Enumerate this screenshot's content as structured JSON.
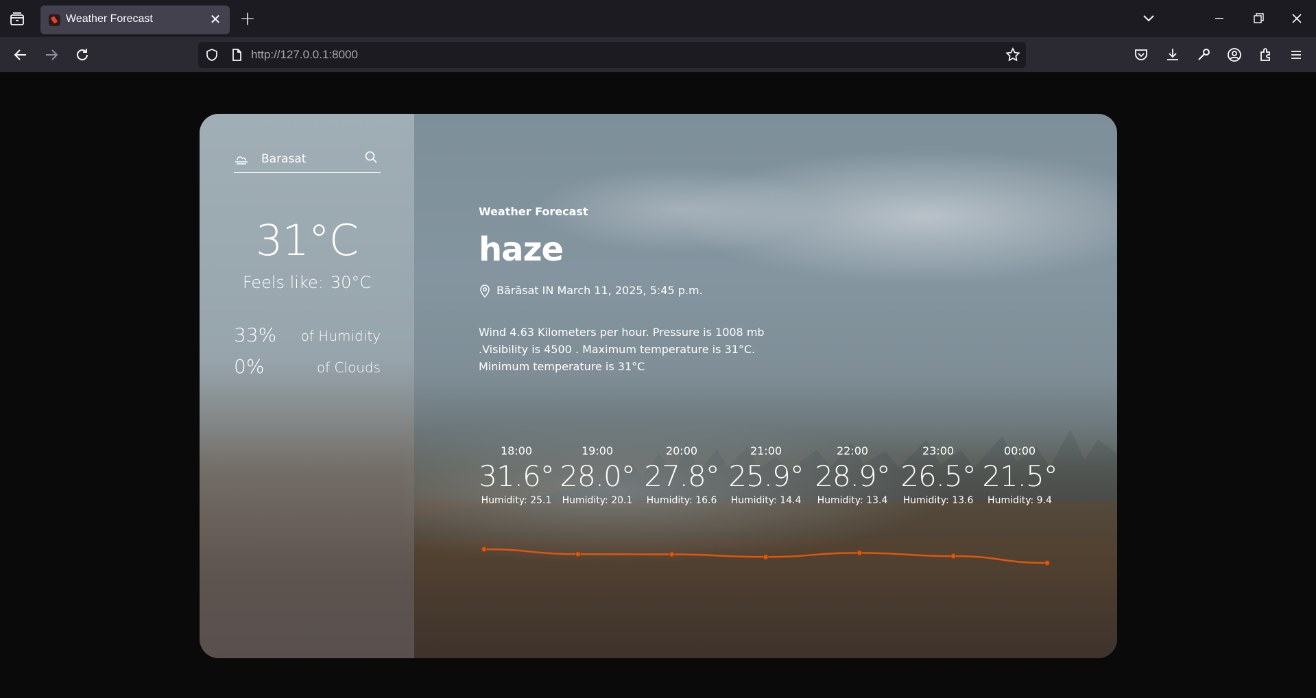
{
  "browser": {
    "tab_title": "Weather Forecast",
    "url_host": "http://127.0.0.1",
    "url_port": ":8000"
  },
  "sidebar": {
    "city": "Barasat",
    "temperature": "31°C",
    "feels_like_label": "Feels like:",
    "feels_like_value": "30°C",
    "humidity_value": "33%",
    "humidity_label": "of Humidity",
    "clouds_value": "0%",
    "clouds_label": "of Clouds"
  },
  "main": {
    "eyebrow": "Weather Forecast",
    "condition": "haze",
    "location": "Bārāsat IN March 11, 2025, 5:45 p.m.",
    "description_lines": [
      "Wind 4.63 Kilometers per hour. Pressure is 1008 mb",
      ".Visibility is 4500 . Maximum temperature is 31°C.",
      "Minimum temperature is 31°C"
    ]
  },
  "hourly": [
    {
      "time": "18:00",
      "temp": "31.6°",
      "humidity": "Humidity: 25.1"
    },
    {
      "time": "19:00",
      "temp": "28.0°",
      "humidity": "Humidity: 20.1"
    },
    {
      "time": "20:00",
      "temp": "27.8°",
      "humidity": "Humidity: 16.6"
    },
    {
      "time": "21:00",
      "temp": "25.9°",
      "humidity": "Humidity: 14.4"
    },
    {
      "time": "22:00",
      "temp": "28.9°",
      "humidity": "Humidity: 13.4"
    },
    {
      "time": "23:00",
      "temp": "26.5°",
      "humidity": "Humidity: 13.6"
    },
    {
      "time": "00:00",
      "temp": "21.5°",
      "humidity": "Humidity: 9.4"
    }
  ],
  "chart_data": {
    "type": "line",
    "x": [
      "18:00",
      "19:00",
      "20:00",
      "21:00",
      "22:00",
      "23:00",
      "00:00"
    ],
    "series": [
      {
        "values": [
          31.6,
          28.0,
          27.8,
          25.9,
          28.9,
          26.5,
          21.5
        ]
      }
    ],
    "color": "#e0570d"
  },
  "colors": {
    "accent_line": "#e0570d",
    "browser_tabbar": "#1c1b22",
    "browser_navbar": "#2b2a33"
  }
}
